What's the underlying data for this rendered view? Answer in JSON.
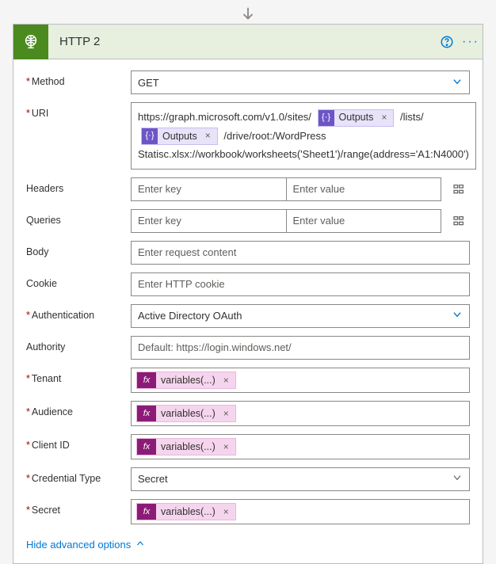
{
  "header": {
    "title": "HTTP 2"
  },
  "fields": {
    "method": {
      "label": "Method",
      "value": "GET"
    },
    "uri": {
      "label": "URI",
      "part1": "https://graph.microsoft.com/v1.0/sites/",
      "token1": "Outputs",
      "part2": "/lists/",
      "token2": "Outputs",
      "part3": "/drive/root:/WordPress Statisc.xlsx://workbook/worksheets('Sheet1')/range(address='A1:N4000')"
    },
    "headers": {
      "label": "Headers",
      "key_ph": "Enter key",
      "val_ph": "Enter value"
    },
    "queries": {
      "label": "Queries",
      "key_ph": "Enter key",
      "val_ph": "Enter value"
    },
    "body": {
      "label": "Body",
      "placeholder": "Enter request content"
    },
    "cookie": {
      "label": "Cookie",
      "placeholder": "Enter HTTP cookie"
    },
    "auth": {
      "label": "Authentication",
      "value": "Active Directory OAuth"
    },
    "authority": {
      "label": "Authority",
      "placeholder": "Default: https://login.windows.net/"
    },
    "tenant": {
      "label": "Tenant",
      "token": "variables(...)"
    },
    "audience": {
      "label": "Audience",
      "token": "variables(...)"
    },
    "clientid": {
      "label": "Client ID",
      "token": "variables(...)"
    },
    "credtype": {
      "label": "Credential Type",
      "value": "Secret"
    },
    "secret": {
      "label": "Secret",
      "token": "variables(...)"
    }
  },
  "fx_label": "fx",
  "outputs_icon": "{·}",
  "close_x": "×",
  "advanced": "Hide advanced options"
}
